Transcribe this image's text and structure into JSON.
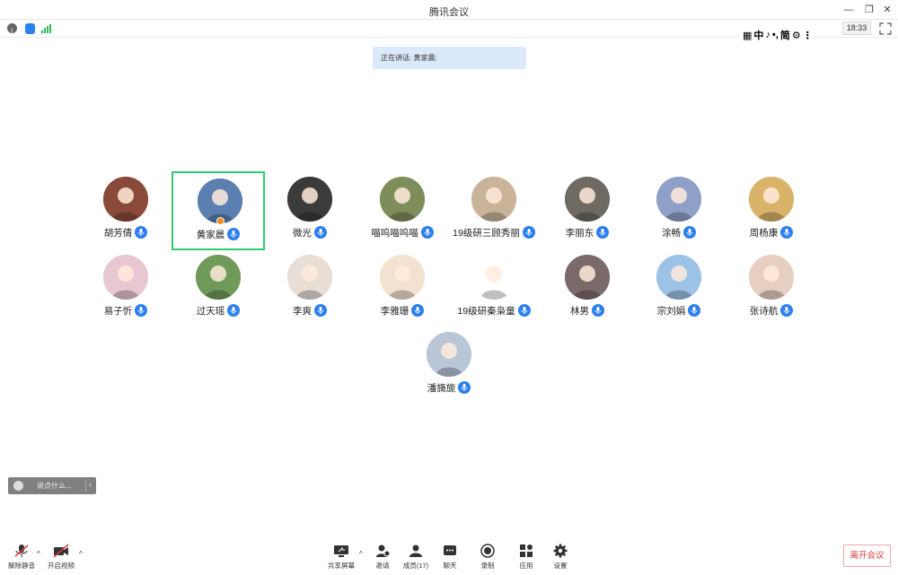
{
  "window": {
    "title": "腾讯会议"
  },
  "info_bar": {
    "clock": "18:33"
  },
  "ime_bar": {
    "items": [
      "中",
      "♪",
      "•,",
      "简",
      "⚙",
      "⋮"
    ]
  },
  "speaking_banner": "正在讲话: 黄家晨;",
  "participants": [
    {
      "name": "胡芳倩",
      "avatar_color": "#8a4a3a"
    },
    {
      "name": "黄家晨",
      "avatar_color": "#5a7fb0",
      "active": true,
      "host": true
    },
    {
      "name": "微光",
      "avatar_color": "#3b3b3b"
    },
    {
      "name": "喵呜喵呜喵",
      "avatar_color": "#7d8e5a"
    },
    {
      "name": "19级研三顾秀丽",
      "avatar_color": "#c9b49a"
    },
    {
      "name": "李丽东",
      "avatar_color": "#6e6a62"
    },
    {
      "name": "涂畅",
      "avatar_color": "#8ea0c8"
    },
    {
      "name": "周杨康",
      "avatar_color": "#d9b36a"
    },
    {
      "name": "易子忻",
      "avatar_color": "#e7c7d2"
    },
    {
      "name": "过天瑶",
      "avatar_color": "#6f9a5a"
    },
    {
      "name": "李爽",
      "avatar_color": "#e8ded6"
    },
    {
      "name": "李雅珊",
      "avatar_color": "#f3e2d0"
    },
    {
      "name": "19级研秦枭童",
      "avatar_color": "#ffffff"
    },
    {
      "name": "林男",
      "avatar_color": "#7a6a6a"
    },
    {
      "name": "宗刘娟",
      "avatar_color": "#9cc3e6"
    },
    {
      "name": "张诗航",
      "avatar_color": "#e6cfc0"
    },
    {
      "name": "潘旖旎",
      "avatar_color": "#b9c6d8"
    }
  ],
  "chat": {
    "placeholder": "说点什么..."
  },
  "toolbar": {
    "mute": "解除静音",
    "video": "开启视频",
    "share": "共享屏幕",
    "invite": "邀请",
    "members": "成员(17)",
    "chat": "聊天",
    "record": "录制",
    "apps": "应用",
    "settings": "设置",
    "leave": "离开会议"
  },
  "colors": {
    "accent": "#2b7ff0",
    "active_border": "#2ecc71",
    "leave": "#e03a3a",
    "banner_bg": "#dbe9fb"
  }
}
